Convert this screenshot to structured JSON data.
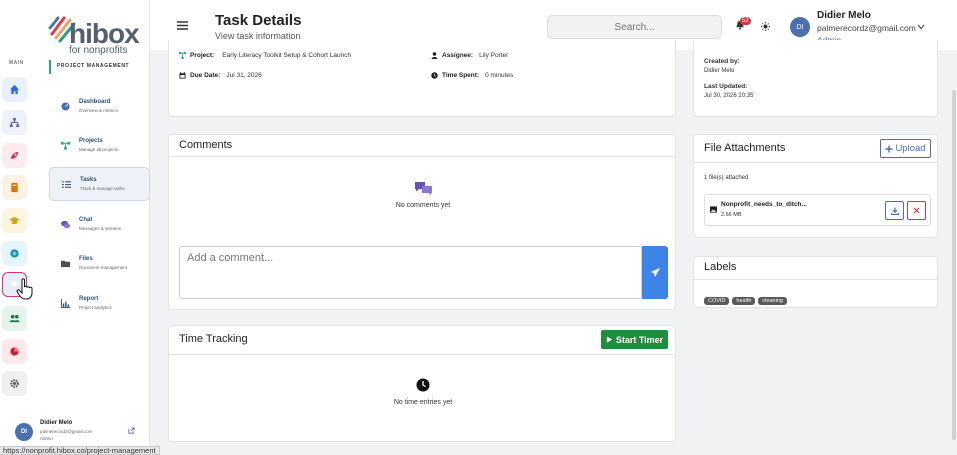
{
  "brand": {
    "name": "hibox",
    "sub": "for nonprofits"
  },
  "rail": {
    "section": "MAIN"
  },
  "sidebar": {
    "section": "PROJECT MANAGEMENT",
    "items": [
      {
        "title": "Dashboard",
        "sub": "Overview & metrics"
      },
      {
        "title": "Projects",
        "sub": "Manage all projects"
      },
      {
        "title": "Tasks",
        "sub": "Track & manage tasks"
      },
      {
        "title": "Chat",
        "sub": "Messages & streams"
      },
      {
        "title": "Files",
        "sub": "Document management"
      },
      {
        "title": "Report",
        "sub": "Project analytics"
      }
    ]
  },
  "footer_user": {
    "initials": "DI",
    "name": "Didier Melo",
    "email": "palmerecordz@gmail.com",
    "role": "Admin"
  },
  "header": {
    "title": "Task Details",
    "subtitle": "View task information",
    "search_placeholder": "Search...",
    "notification_count": "52",
    "user_initials": "DI",
    "user_name": "Didier Melo",
    "user_email": "palmerecordz@gmail.com",
    "user_role": "Admin"
  },
  "task": {
    "project_label": "Project:",
    "project_value": "Early Literacy Toolkit Setup & Cohort Launch",
    "assignee_label": "Assignee:",
    "assignee_value": "Lily Porter",
    "due_label": "Due Date:",
    "due_value": "Jul 31, 2026",
    "time_label": "Time Spent:",
    "time_value": "0 minutes"
  },
  "info": {
    "created_by_label": "Created by:",
    "created_by_value": "Didier Melo",
    "last_updated_label": "Last Updated:",
    "last_updated_value": "Jul 30, 2026 20:35"
  },
  "comments": {
    "title": "Comments",
    "empty": "No comments yet",
    "placeholder": "Add a comment..."
  },
  "time_tracking": {
    "title": "Time Tracking",
    "start_label": "Start Timer",
    "empty": "No time entries yet"
  },
  "attachments": {
    "title": "File Attachments",
    "upload_label": "Upload",
    "count_text": "1 file(s) attached",
    "file": {
      "name": "Nonprofit_needs_to_ditch...",
      "size": "2.66 MB"
    }
  },
  "labels": {
    "title": "Labels",
    "tags": [
      "COVID",
      "health",
      "cleaning"
    ]
  },
  "status_url": "https://nonprofit.hibox.co/project-management",
  "colors": {
    "primary": "#4c6fae",
    "green": "#1e8e3e",
    "send": "#3d84e6",
    "danger": "#d9363e"
  }
}
